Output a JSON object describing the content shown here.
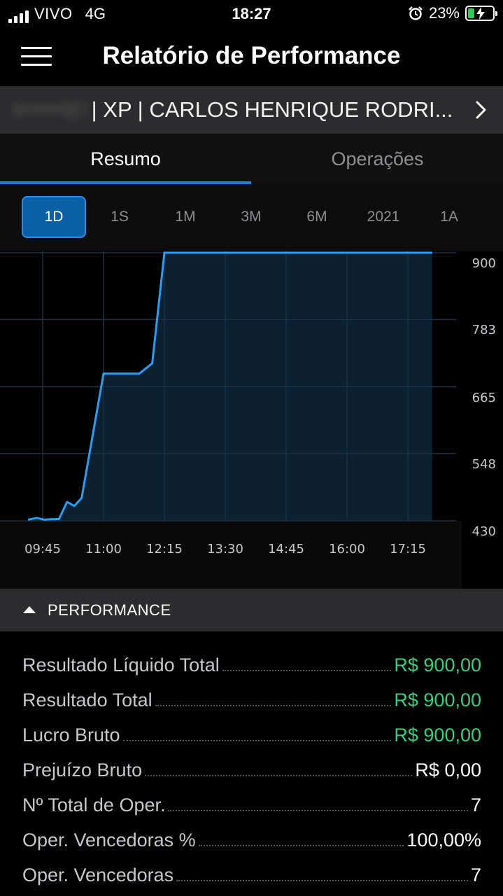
{
  "status_bar": {
    "carrier": "VIVO",
    "network": "4G",
    "time": "18:27",
    "battery_percent": "23%",
    "icons": [
      "signal-icon",
      "alarm-icon",
      "battery-charging-icon"
    ]
  },
  "header": {
    "title": "Relatório de Performance",
    "menu_icon": "hamburger-menu-icon"
  },
  "account": {
    "hidden_id": "4•••••90",
    "text": " | XP | CARLOS HENRIQUE RODRI...",
    "chevron_icon": "chevron-right-icon"
  },
  "tabs": [
    {
      "label": "Resumo",
      "active": true
    },
    {
      "label": "Operações",
      "active": false
    }
  ],
  "periods": [
    {
      "label": "1D",
      "active": true
    },
    {
      "label": "1S",
      "active": false
    },
    {
      "label": "1M",
      "active": false
    },
    {
      "label": "3M",
      "active": false
    },
    {
      "label": "6M",
      "active": false
    },
    {
      "label": "2021",
      "active": false
    },
    {
      "label": "1A",
      "active": false
    }
  ],
  "chart_data": {
    "type": "area",
    "x_ticks": [
      "09:45",
      "11:00",
      "12:15",
      "13:30",
      "14:45",
      "16:00",
      "17:15"
    ],
    "y_ticks": [
      "900",
      "783",
      "665",
      "548",
      "430"
    ],
    "ylim": [
      430,
      900
    ],
    "x_range": [
      "09:27",
      "17:45"
    ],
    "grid": true,
    "line_color": "#2a9ef2",
    "fill_color": "#0c2436",
    "points": [
      [
        "09:27",
        432
      ],
      [
        "09:38",
        435
      ],
      [
        "09:47",
        432
      ],
      [
        "09:56",
        433
      ],
      [
        "10:05",
        433
      ],
      [
        "10:15",
        463
      ],
      [
        "10:24",
        456
      ],
      [
        "10:33",
        470
      ],
      [
        "11:00",
        688
      ],
      [
        "11:44",
        688
      ],
      [
        "12:00",
        706
      ],
      [
        "12:15",
        900
      ],
      [
        "17:45",
        900
      ]
    ]
  },
  "performance": {
    "title": "PERFORMANCE",
    "caret_icon": "caret-up-icon",
    "rows": [
      {
        "label": "Resultado Líquido Total",
        "value": "R$ 900,00",
        "color": "#35d07f"
      },
      {
        "label": "Resultado Total",
        "value": "R$ 900,00",
        "color": "#35d07f"
      },
      {
        "label": "Lucro Bruto",
        "value": "R$ 900,00",
        "color": "#35d07f"
      },
      {
        "label": "Prejuízo Bruto",
        "value": "R$ 0,00",
        "color": "#ffffff"
      },
      {
        "label": "Nº Total de Oper.",
        "value": "7",
        "color": "#ffffff"
      },
      {
        "label": "Oper. Vencedoras %",
        "value": "100,00%",
        "color": "#ffffff"
      },
      {
        "label": "Oper. Vencedoras",
        "value": "7",
        "color": "#ffffff"
      }
    ]
  }
}
